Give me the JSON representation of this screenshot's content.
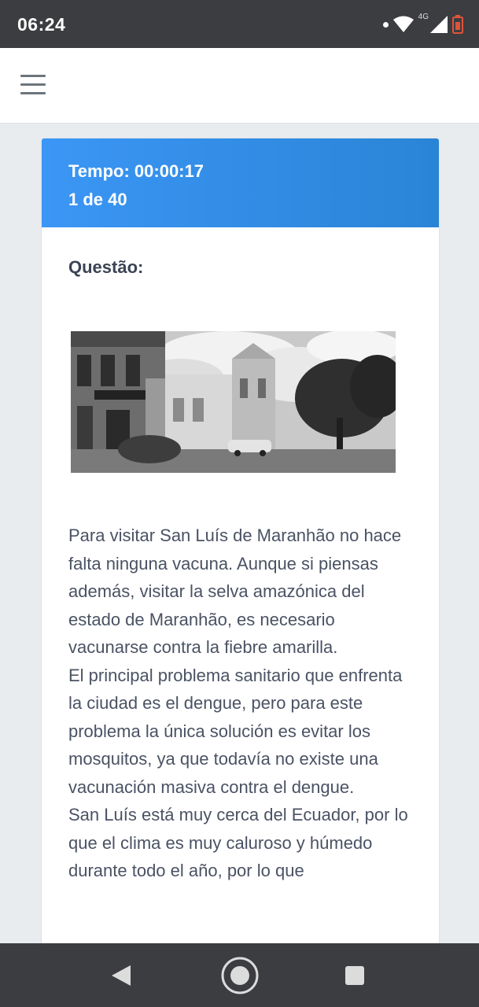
{
  "status_bar": {
    "time": "06:24",
    "network_label": "4G",
    "icons": [
      "notification-dot",
      "wifi-icon",
      "signal-icon",
      "battery-low-icon"
    ]
  },
  "header": {
    "menu_icon": "hamburger-menu-icon"
  },
  "quiz": {
    "timer": "Tempo: 00:00:17",
    "progress": "1 de 40",
    "question_label": "Questão:",
    "image": "black-and-white photo of a street with colonial buildings, a parked car and a tree",
    "paragraphs": [
      "Para visitar San Luís de Maranhão no hace falta ninguna vacuna. Aunque si piensas además, visitar la selva amazónica del estado de Maranhão, es necesario vacunarse contra la fiebre amarilla.",
      "El principal problema sanitario que enfrenta la ciudad es el dengue, pero para este problema la única solución es evitar los mosquitos, ya que todavía no existe una vacunación masiva contra el dengue.",
      "San Luís está muy cerca del Ecuador, por lo que el clima es muy caluroso y húmedo durante todo el año, por lo que"
    ]
  },
  "colors": {
    "header_gradient_start": "#3b96f5",
    "header_gradient_end": "#2a84d6",
    "page_background": "#e9ecef",
    "system_bar": "#3c3d40"
  },
  "nav_bar": {
    "buttons": [
      "back-icon",
      "home-icon",
      "recents-icon"
    ]
  }
}
